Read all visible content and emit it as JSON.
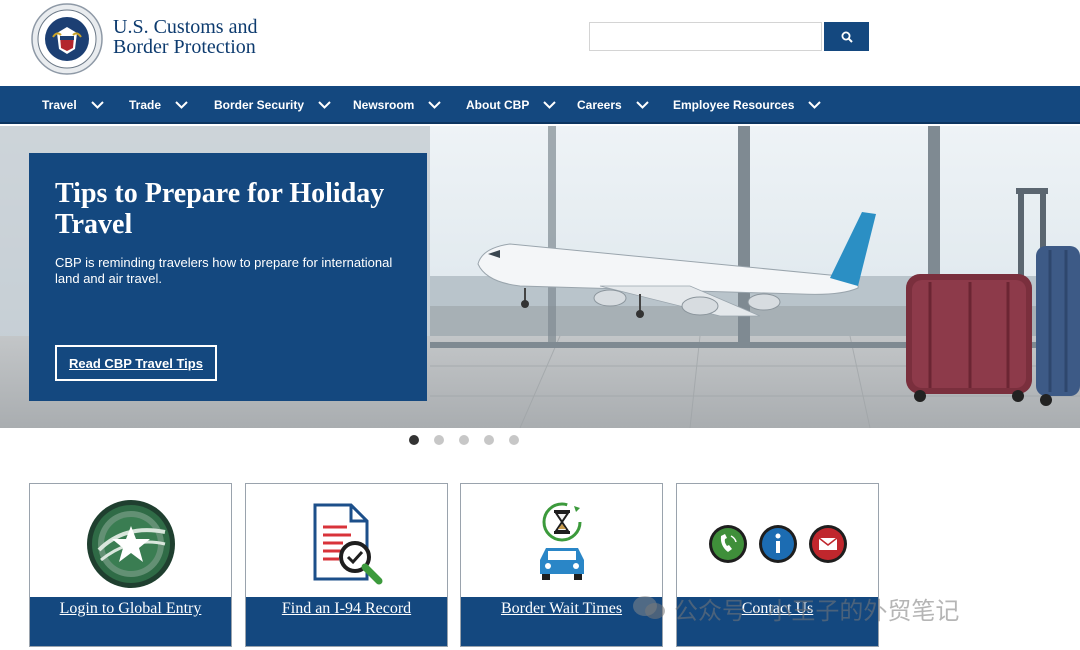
{
  "site": {
    "agency_line1": "U.S. Customs and",
    "agency_line2": "Border Protection",
    "brand_color": "#14487f"
  },
  "search": {
    "value": "",
    "placeholder": "",
    "button_icon": "search-icon"
  },
  "nav": {
    "items": [
      {
        "label": "Travel"
      },
      {
        "label": "Trade"
      },
      {
        "label": "Border Security"
      },
      {
        "label": "Newsroom"
      },
      {
        "label": "About CBP"
      },
      {
        "label": "Careers"
      },
      {
        "label": "Employee Resources"
      }
    ]
  },
  "hero": {
    "title": "Tips to Prepare for Holiday Travel",
    "text": "CBP is reminding travelers how to prepare for international land and air travel.",
    "button_label": "Read CBP Travel Tips",
    "slides_count": 5,
    "active_slide": 1
  },
  "cards": [
    {
      "label": "Login to Global Entry",
      "icon": "global-entry-star-icon"
    },
    {
      "label": "Find an I-94 Record",
      "icon": "document-search-icon"
    },
    {
      "label": "Border Wait Times",
      "icon": "hourglass-car-icon"
    },
    {
      "label": "Contact Us",
      "icon": "phone-info-mail-icons"
    }
  ],
  "watermark": {
    "text": "公众号 · 小王子的外贸笔记"
  }
}
